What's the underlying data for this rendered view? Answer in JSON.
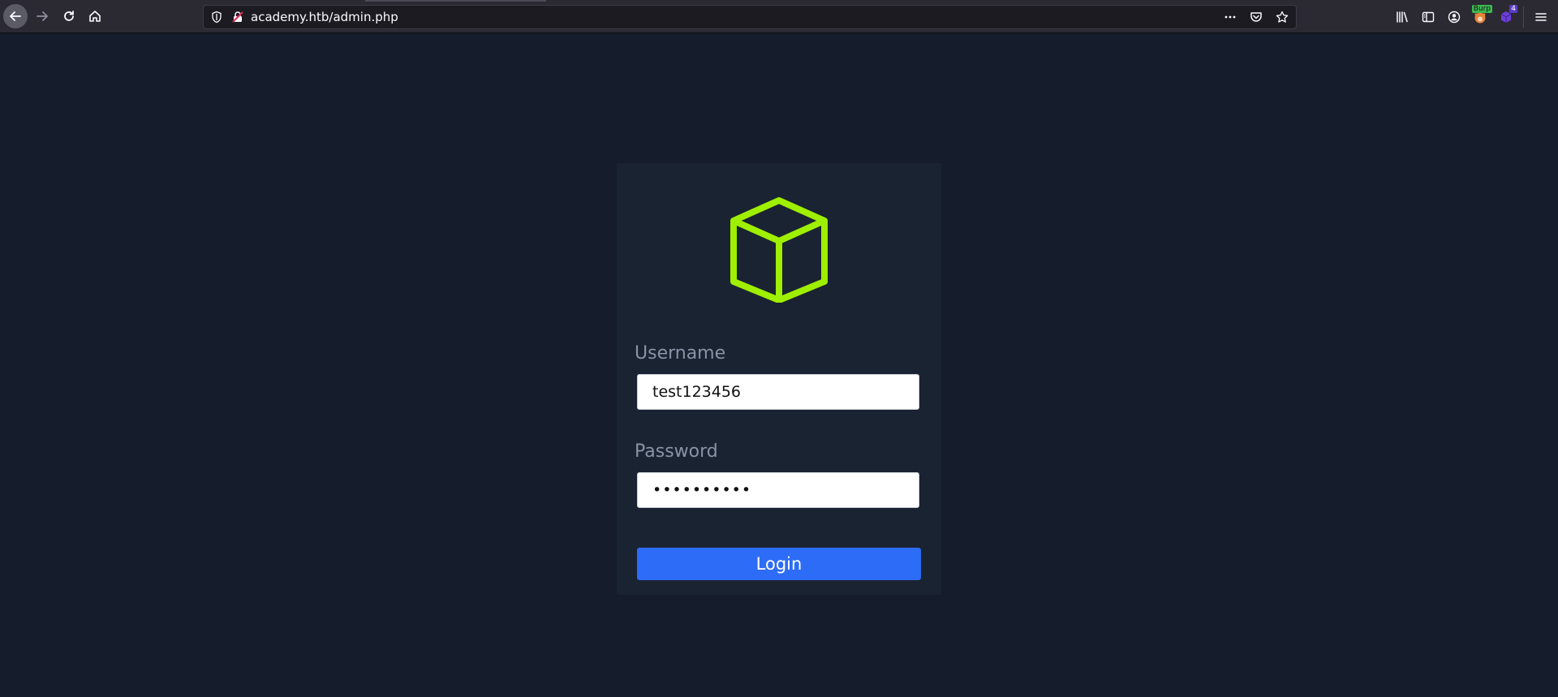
{
  "browser": {
    "url": "academy.htb/admin.php",
    "extensions": {
      "burp_badge": "Burp",
      "count_badge": "4"
    }
  },
  "login": {
    "username_label": "Username",
    "username_value": "test123456",
    "password_label": "Password",
    "password_value": "••••••••••",
    "submit_label": "Login"
  },
  "colors": {
    "page_background": "#151d2c",
    "card_background": "#1a2332",
    "logo": "#9fef00",
    "button": "#2d6cf6",
    "label": "#8a93a5"
  }
}
